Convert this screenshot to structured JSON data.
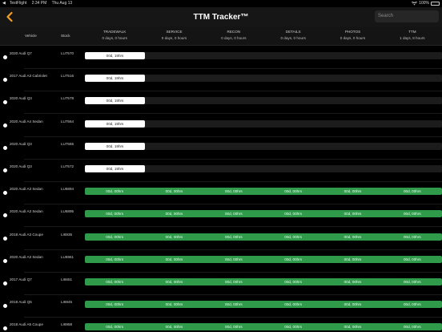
{
  "status_bar": {
    "carrier": "TestFlight",
    "time": "2:34 PM",
    "date": "Thu Aug 13",
    "battery": "100%"
  },
  "nav": {
    "title": "TTM Tracker™",
    "search_placeholder": "Search"
  },
  "columns": {
    "vehicle": "Vehicle",
    "stock": "Stock"
  },
  "stages": [
    {
      "name": "TRADEWALK",
      "total": "0 days, 0 hours"
    },
    {
      "name": "SERVICE",
      "total": "0 days, 0 hours"
    },
    {
      "name": "RECON",
      "total": "0 days, 0 hours"
    },
    {
      "name": "DETAILS",
      "total": "0 days, 0 hours"
    },
    {
      "name": "PHOTOS",
      "total": "0 days, 0 hours"
    },
    {
      "name": "TTM",
      "total": "1 days, 8 hours"
    }
  ],
  "rows": [
    {
      "vehicle": "2020 Audi Q7",
      "stock": "LU7570",
      "kind": "white",
      "time": "00d, 19hrs"
    },
    {
      "vehicle": "2017 Audi A3 Cabriolet",
      "stock": "LU7516",
      "kind": "white",
      "time": "00d, 19hrs"
    },
    {
      "vehicle": "2020 Audi Q3",
      "stock": "LU7578",
      "kind": "white",
      "time": "00d, 19hrs"
    },
    {
      "vehicle": "2020 Audi A4 Sedan",
      "stock": "LU7564",
      "kind": "white",
      "time": "00d, 19hrs"
    },
    {
      "vehicle": "2020 Audi Q3",
      "stock": "LU7565",
      "kind": "white",
      "time": "00d, 19hrs"
    },
    {
      "vehicle": "2020 Audi Q3",
      "stock": "LU7572",
      "kind": "white",
      "time": "00d, 19hrs"
    },
    {
      "vehicle": "2020 Audi A3 Sedan",
      "stock": "LU6894",
      "kind": "green",
      "time": "00d, 00hrs"
    },
    {
      "vehicle": "2020 Audi A3 Sedan",
      "stock": "LU6895",
      "kind": "green",
      "time": "00d, 00hrs"
    },
    {
      "vehicle": "2018 Audi A3 Coupe",
      "stock": "LI6935",
      "kind": "green",
      "time": "00d, 00hrs"
    },
    {
      "vehicle": "2020 Audi A3 Sedan",
      "stock": "LU6961",
      "kind": "green",
      "time": "00d, 00hrs"
    },
    {
      "vehicle": "2017 Audi Q7",
      "stock": "LI6651",
      "kind": "green",
      "time": "00d, 00hrs"
    },
    {
      "vehicle": "2018 Audi Q5",
      "stock": "LI6945",
      "kind": "green",
      "time": "00d, 00hrs"
    },
    {
      "vehicle": "2018 Audi A5 Coupe",
      "stock": "LI6958",
      "kind": "green",
      "time": "00d, 00hrs"
    }
  ],
  "colors": {
    "background": "#000000",
    "navbar": "#161616",
    "accent_back": "#f0a028",
    "progress_green": "#2e9a4a"
  },
  "icons": {
    "back": "chevron-left-icon",
    "wifi": "wifi-icon",
    "battery": "battery-icon",
    "testflight_back": "back-triangle-icon"
  }
}
